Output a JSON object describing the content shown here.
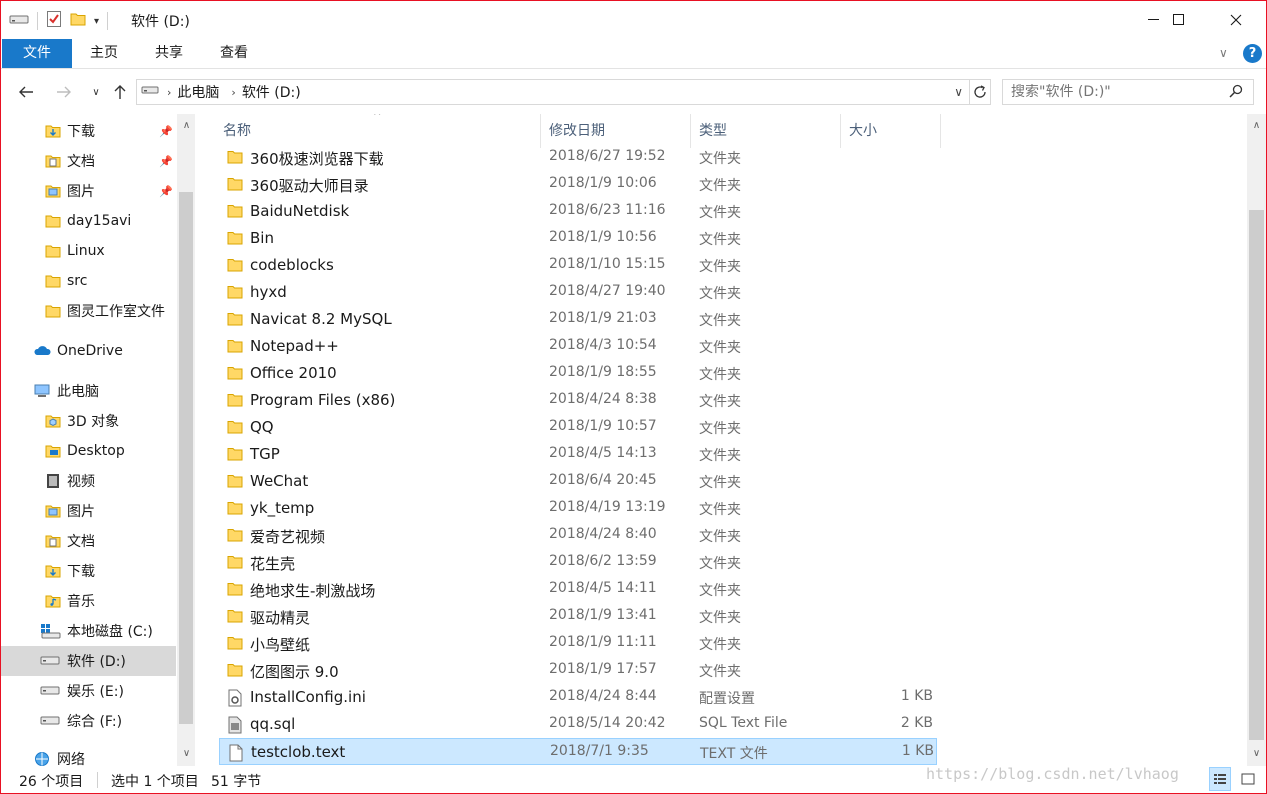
{
  "window": {
    "title": "软件 (D:)"
  },
  "ribbon": {
    "tabs": [
      "文件",
      "主页",
      "共享",
      "查看"
    ]
  },
  "address": {
    "breadcrumbs": [
      "此电脑",
      "软件 (D:)"
    ],
    "search_placeholder": "搜索\"软件 (D:)\""
  },
  "sidebar": {
    "quick_access": [
      {
        "label": "下载",
        "pinned": true,
        "icon": "download-folder-icon"
      },
      {
        "label": "文档",
        "pinned": true,
        "icon": "documents-folder-icon"
      },
      {
        "label": "图片",
        "pinned": true,
        "icon": "pictures-folder-icon"
      },
      {
        "label": "day15avi",
        "pinned": false,
        "icon": "folder-icon"
      },
      {
        "label": "Linux",
        "pinned": false,
        "icon": "folder-icon"
      },
      {
        "label": "src",
        "pinned": false,
        "icon": "folder-icon"
      },
      {
        "label": "图灵工作室文件",
        "pinned": false,
        "icon": "folder-icon"
      }
    ],
    "onedrive": "OneDrive",
    "this_pc": "此电脑",
    "pc_items": [
      {
        "label": "3D 对象",
        "icon": "3d-objects-icon"
      },
      {
        "label": "Desktop",
        "icon": "desktop-folder-icon"
      },
      {
        "label": "视频",
        "icon": "videos-folder-icon"
      },
      {
        "label": "图片",
        "icon": "pictures-folder-icon"
      },
      {
        "label": "文档",
        "icon": "documents-folder-icon"
      },
      {
        "label": "下载",
        "icon": "download-folder-icon"
      },
      {
        "label": "音乐",
        "icon": "music-folder-icon"
      },
      {
        "label": "本地磁盘 (C:)",
        "icon": "windows-drive-icon"
      },
      {
        "label": "软件 (D:)",
        "icon": "drive-icon",
        "selected": true
      },
      {
        "label": "娱乐 (E:)",
        "icon": "drive-icon"
      },
      {
        "label": "综合 (F:)",
        "icon": "drive-icon"
      }
    ],
    "network": "网络"
  },
  "columns": {
    "name": "名称",
    "date": "修改日期",
    "type": "类型",
    "size": "大小"
  },
  "files": [
    {
      "name": "360极速浏览器下载",
      "date": "2018/6/27 19:52",
      "type": "文件夹",
      "size": "",
      "kind": "folder"
    },
    {
      "name": "360驱动大师目录",
      "date": "2018/1/9 10:06",
      "type": "文件夹",
      "size": "",
      "kind": "folder"
    },
    {
      "name": "BaiduNetdisk",
      "date": "2018/6/23 11:16",
      "type": "文件夹",
      "size": "",
      "kind": "folder"
    },
    {
      "name": "Bin",
      "date": "2018/1/9 10:56",
      "type": "文件夹",
      "size": "",
      "kind": "folder"
    },
    {
      "name": "codeblocks",
      "date": "2018/1/10 15:15",
      "type": "文件夹",
      "size": "",
      "kind": "folder"
    },
    {
      "name": "hyxd",
      "date": "2018/4/27 19:40",
      "type": "文件夹",
      "size": "",
      "kind": "folder"
    },
    {
      "name": "Navicat 8.2 MySQL",
      "date": "2018/1/9 21:03",
      "type": "文件夹",
      "size": "",
      "kind": "folder"
    },
    {
      "name": "Notepad++",
      "date": "2018/4/3 10:54",
      "type": "文件夹",
      "size": "",
      "kind": "folder"
    },
    {
      "name": "Office 2010",
      "date": "2018/1/9 18:55",
      "type": "文件夹",
      "size": "",
      "kind": "folder"
    },
    {
      "name": "Program Files (x86)",
      "date": "2018/4/24 8:38",
      "type": "文件夹",
      "size": "",
      "kind": "folder"
    },
    {
      "name": "QQ",
      "date": "2018/1/9 10:57",
      "type": "文件夹",
      "size": "",
      "kind": "folder"
    },
    {
      "name": "TGP",
      "date": "2018/4/5 14:13",
      "type": "文件夹",
      "size": "",
      "kind": "folder"
    },
    {
      "name": "WeChat",
      "date": "2018/6/4 20:45",
      "type": "文件夹",
      "size": "",
      "kind": "folder"
    },
    {
      "name": "yk_temp",
      "date": "2018/4/19 13:19",
      "type": "文件夹",
      "size": "",
      "kind": "folder"
    },
    {
      "name": "爱奇艺视频",
      "date": "2018/4/24 8:40",
      "type": "文件夹",
      "size": "",
      "kind": "folder"
    },
    {
      "name": "花生壳",
      "date": "2018/6/2 13:59",
      "type": "文件夹",
      "size": "",
      "kind": "folder"
    },
    {
      "name": "绝地求生-刺激战场",
      "date": "2018/4/5 14:11",
      "type": "文件夹",
      "size": "",
      "kind": "folder"
    },
    {
      "name": "驱动精灵",
      "date": "2018/1/9 13:41",
      "type": "文件夹",
      "size": "",
      "kind": "folder"
    },
    {
      "name": "小鸟壁纸",
      "date": "2018/1/9 11:11",
      "type": "文件夹",
      "size": "",
      "kind": "folder"
    },
    {
      "name": "亿图图示 9.0",
      "date": "2018/1/9 17:57",
      "type": "文件夹",
      "size": "",
      "kind": "folder"
    },
    {
      "name": "InstallConfig.ini",
      "date": "2018/4/24 8:44",
      "type": "配置设置",
      "size": "1 KB",
      "kind": "ini"
    },
    {
      "name": "qq.sql",
      "date": "2018/5/14 20:42",
      "type": "SQL Text File",
      "size": "2 KB",
      "kind": "sql"
    },
    {
      "name": "testclob.text",
      "date": "2018/7/1 9:35",
      "type": "TEXT 文件",
      "size": "1 KB",
      "kind": "file",
      "selected": true
    }
  ],
  "status": {
    "count": "26 个项目",
    "selected": "选中 1 个项目",
    "size": "51 字节"
  },
  "watermark": "https://blog.csdn.net/lvhaog",
  "colors": {
    "accent": "#1979ca",
    "selection": "#cce8ff",
    "folder": "#ffd866",
    "border": "#e81123"
  }
}
